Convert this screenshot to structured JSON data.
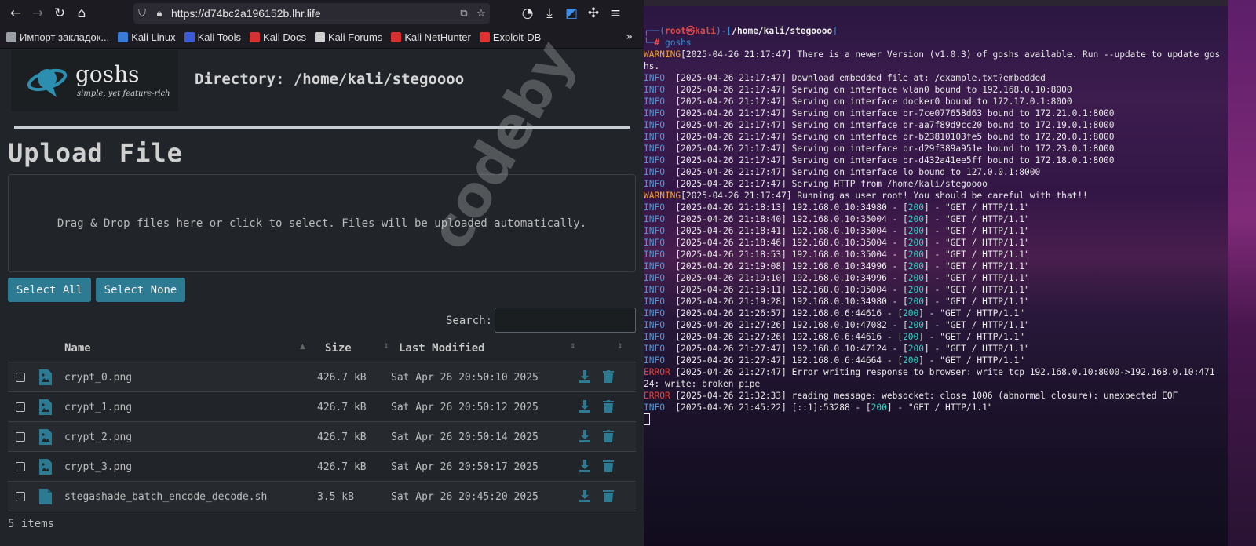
{
  "browser": {
    "url": "https://d74bc2a196152b.lhr.life",
    "bookmarks": [
      "Импорт закладок...",
      "Kali Linux",
      "Kali Tools",
      "Kali Docs",
      "Kali Forums",
      "Kali NetHunter",
      "Exploit-DB"
    ],
    "bookmark_colors": [
      "#9aa0a6",
      "#3a7bd5",
      "#3b5bdb",
      "#d63030",
      "#cfcfcf",
      "#d63030",
      "#e03030"
    ]
  },
  "app": {
    "logo_name": "goshs",
    "logo_tagline": "simple, yet feature-rich",
    "directory_title": "Directory: /home/kali/stegoooo",
    "upload_title": "Upload File",
    "dropzone_text": "Drag & Drop files here or click to select. Files will be uploaded automatically.",
    "select_all": "Select All",
    "select_none": "Select None",
    "search_label": "Search:",
    "columns": {
      "name": "Name",
      "size": "Size",
      "modified": "Last Modified"
    },
    "files": [
      {
        "name": "crypt_0.png",
        "size": "426.7 kB",
        "modified": "Sat Apr 26 20:50:10 2025",
        "type": "image"
      },
      {
        "name": "crypt_1.png",
        "size": "426.7 kB",
        "modified": "Sat Apr 26 20:50:12 2025",
        "type": "image"
      },
      {
        "name": "crypt_2.png",
        "size": "426.7 kB",
        "modified": "Sat Apr 26 20:50:14 2025",
        "type": "image"
      },
      {
        "name": "crypt_3.png",
        "size": "426.7 kB",
        "modified": "Sat Apr 26 20:50:17 2025",
        "type": "image"
      },
      {
        "name": "stegashade_batch_encode_decode.sh",
        "size": "3.5 kB",
        "modified": "Sat Apr 26 20:45:20 2025",
        "type": "file"
      }
    ],
    "items_count": "5 items",
    "accent": "#2d7a93"
  },
  "terminal": {
    "prompt_user": "root㉿kali",
    "prompt_path": "/home/kali/stegoooo",
    "command": "goshs",
    "lines": [
      {
        "lv": "WARNING",
        "ts": "[2025-04-26 21:17:47]",
        "msg": " There is a newer Version (v1.0.3) of goshs available. Run --update to update gos"
      },
      {
        "cont": "hs."
      },
      {
        "lv": "INFO",
        "ts": "[2025-04-26 21:17:47]",
        "msg": " Download embedded file at: /example.txt?embedded"
      },
      {
        "lv": "INFO",
        "ts": "[2025-04-26 21:17:47]",
        "msg": " Serving on interface wlan0 bound to 192.168.0.10:8000"
      },
      {
        "lv": "INFO",
        "ts": "[2025-04-26 21:17:47]",
        "msg": " Serving on interface docker0 bound to 172.17.0.1:8000"
      },
      {
        "lv": "INFO",
        "ts": "[2025-04-26 21:17:47]",
        "msg": " Serving on interface br-7ce077658d63 bound to 172.21.0.1:8000"
      },
      {
        "lv": "INFO",
        "ts": "[2025-04-26 21:17:47]",
        "msg": " Serving on interface br-aa7f89d9cc20 bound to 172.19.0.1:8000"
      },
      {
        "lv": "INFO",
        "ts": "[2025-04-26 21:17:47]",
        "msg": " Serving on interface br-b23810103fe5 bound to 172.20.0.1:8000"
      },
      {
        "lv": "INFO",
        "ts": "[2025-04-26 21:17:47]",
        "msg": " Serving on interface br-d29f389a951e bound to 172.23.0.1:8000"
      },
      {
        "lv": "INFO",
        "ts": "[2025-04-26 21:17:47]",
        "msg": " Serving on interface br-d432a41ee5ff bound to 172.18.0.1:8000"
      },
      {
        "lv": "INFO",
        "ts": "[2025-04-26 21:17:47]",
        "msg": " Serving on interface lo bound to 127.0.0.1:8000"
      },
      {
        "lv": "INFO",
        "ts": "[2025-04-26 21:17:47]",
        "msg": " Serving HTTP from /home/kali/stegoooo"
      },
      {
        "lv": "WARNING",
        "ts": "[2025-04-26 21:17:47]",
        "msg": " Running as user root! You should be careful with that!!"
      },
      {
        "lv": "INFO",
        "ts": "[2025-04-26 21:18:13]",
        "pre": " 192.168.0.10:34980 - [",
        "code": "200",
        "post": "] - \"GET / HTTP/1.1\""
      },
      {
        "lv": "INFO",
        "ts": "[2025-04-26 21:18:40]",
        "pre": " 192.168.0.10:35004 - [",
        "code": "200",
        "post": "] - \"GET / HTTP/1.1\""
      },
      {
        "lv": "INFO",
        "ts": "[2025-04-26 21:18:41]",
        "pre": " 192.168.0.10:35004 - [",
        "code": "200",
        "post": "] - \"GET / HTTP/1.1\""
      },
      {
        "lv": "INFO",
        "ts": "[2025-04-26 21:18:46]",
        "pre": " 192.168.0.10:35004 - [",
        "code": "200",
        "post": "] - \"GET / HTTP/1.1\""
      },
      {
        "lv": "INFO",
        "ts": "[2025-04-26 21:18:53]",
        "pre": " 192.168.0.10:35004 - [",
        "code": "200",
        "post": "] - \"GET / HTTP/1.1\""
      },
      {
        "lv": "INFO",
        "ts": "[2025-04-26 21:19:08]",
        "pre": " 192.168.0.10:34996 - [",
        "code": "200",
        "post": "] - \"GET / HTTP/1.1\""
      },
      {
        "lv": "INFO",
        "ts": "[2025-04-26 21:19:10]",
        "pre": " 192.168.0.10:34996 - [",
        "code": "200",
        "post": "] - \"GET / HTTP/1.1\""
      },
      {
        "lv": "INFO",
        "ts": "[2025-04-26 21:19:11]",
        "pre": " 192.168.0.10:35004 - [",
        "code": "200",
        "post": "] - \"GET / HTTP/1.1\""
      },
      {
        "lv": "INFO",
        "ts": "[2025-04-26 21:19:28]",
        "pre": " 192.168.0.10:34980 - [",
        "code": "200",
        "post": "] - \"GET / HTTP/1.1\""
      },
      {
        "lv": "INFO",
        "ts": "[2025-04-26 21:26:57]",
        "pre": " 192.168.0.6:44616 - [",
        "code": "200",
        "post": "] - \"GET / HTTP/1.1\""
      },
      {
        "lv": "INFO",
        "ts": "[2025-04-26 21:27:26]",
        "pre": " 192.168.0.10:47082 - [",
        "code": "200",
        "post": "] - \"GET / HTTP/1.1\""
      },
      {
        "lv": "INFO",
        "ts": "[2025-04-26 21:27:26]",
        "pre": " 192.168.0.6:44616 - [",
        "code": "200",
        "post": "] - \"GET / HTTP/1.1\""
      },
      {
        "lv": "INFO",
        "ts": "[2025-04-26 21:27:47]",
        "pre": " 192.168.0.10:47124 - [",
        "code": "200",
        "post": "] - \"GET / HTTP/1.1\""
      },
      {
        "lv": "INFO",
        "ts": "[2025-04-26 21:27:47]",
        "pre": " 192.168.0.6:44664 - [",
        "code": "200",
        "post": "] - \"GET / HTTP/1.1\""
      },
      {
        "lv": "ERROR",
        "ts": "[2025-04-26 21:27:47]",
        "msg": " Error writing response to browser: write tcp 192.168.0.10:8000->192.168.0.10:471"
      },
      {
        "cont": "24: write: broken pipe"
      },
      {
        "lv": "ERROR",
        "ts": "[2025-04-26 21:32:33]",
        "msg": " reading message: websocket: close 1006 (abnormal closure): unexpected EOF"
      },
      {
        "lv": "INFO",
        "ts": "[2025-04-26 21:45:22]",
        "pre": " [::1]:53288 - [",
        "code": "200",
        "post": "] - \"GET / HTTP/1.1\""
      }
    ]
  },
  "watermark": "codeby"
}
